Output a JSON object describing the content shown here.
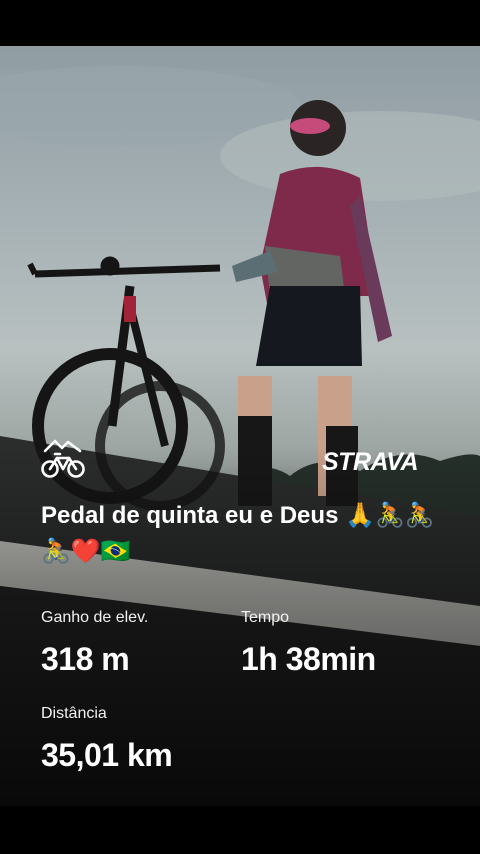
{
  "brand": {
    "name": "STRAVA",
    "activity_icon": "cycling-icon"
  },
  "activity": {
    "title": "Pedal de quinta eu e Deus 🙏🚴🚴🚴❤️🇧🇷"
  },
  "stats": {
    "elevation": {
      "label": "Ganho de elev.",
      "value": "318 m"
    },
    "time": {
      "label": "Tempo",
      "value": "1h 38min"
    },
    "distance": {
      "label": "Distância",
      "value": "35,01 km"
    }
  }
}
